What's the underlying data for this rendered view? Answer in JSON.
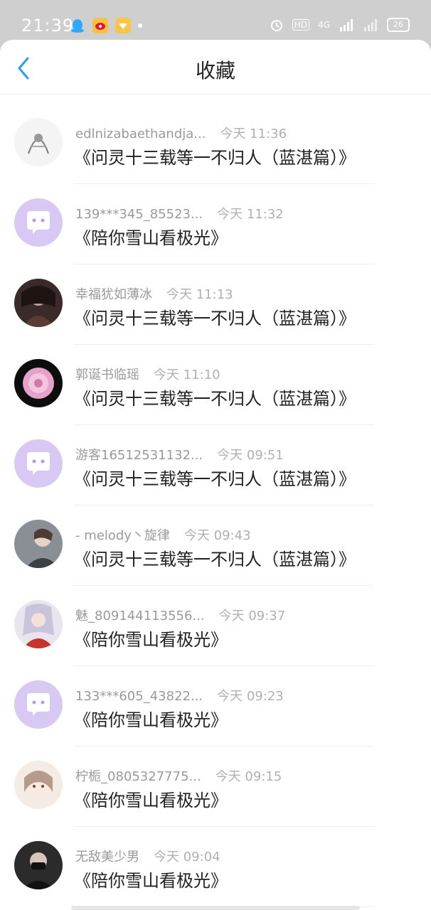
{
  "status": {
    "time": "21:39",
    "battery": "26",
    "network": "4G",
    "hd": "HD"
  },
  "header": {
    "title": "收藏"
  },
  "items": [
    {
      "name": "edlnizabaethandja...",
      "time": "今天 11:36",
      "title": "《问灵十三载等一不归人（蓝湛篇）》",
      "avatar": "sketch"
    },
    {
      "name": "139***345_85523...",
      "time": "今天 11:32",
      "title": "《陪你雪山看极光》",
      "avatar": "default"
    },
    {
      "name": "幸福犹如薄冰",
      "time": "今天 11:13",
      "title": "《问灵十三载等一不归人（蓝湛篇）》",
      "avatar": "dark"
    },
    {
      "name": "郭诞书临瑶",
      "time": "今天 11:10",
      "title": "《问灵十三载等一不归人（蓝湛篇）》",
      "avatar": "rose"
    },
    {
      "name": "游客16512531132...",
      "time": "今天 09:51",
      "title": "《问灵十三载等一不归人（蓝湛篇）》",
      "avatar": "default"
    },
    {
      "name": "- melody丶旋律",
      "time": "今天 09:43",
      "title": "《问灵十三载等一不归人（蓝湛篇）》",
      "avatar": "photo"
    },
    {
      "name": "魅_809144113556...",
      "time": "今天 09:37",
      "title": "《陪你雪山看极光》",
      "avatar": "anime"
    },
    {
      "name": "133***605_43822...",
      "time": "今天 09:23",
      "title": "《陪你雪山看极光》",
      "avatar": "default"
    },
    {
      "name": "柠栀_0805327775...",
      "time": "今天 09:15",
      "title": "《陪你雪山看极光》",
      "avatar": "cute"
    },
    {
      "name": "无敌美少男",
      "time": "今天 09:04",
      "title": "《陪你雪山看极光》",
      "avatar": "masked"
    }
  ],
  "colors": {
    "accent": "#2a9df4",
    "default_avatar": "#d7c9f3"
  }
}
